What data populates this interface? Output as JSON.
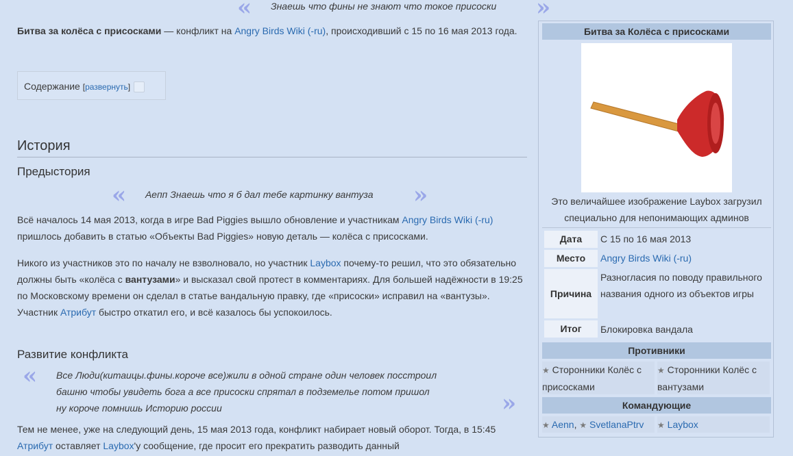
{
  "top_quote": "Знаешь что фины не знают что токое присоски",
  "intro": {
    "bold": "Битва за колёса с присосками",
    "t1": " — конфликт на ",
    "link": "Angry Birds Wiki (-ru)",
    "t2": ", происходивший с 15 по 16 мая 2013 года."
  },
  "toc": {
    "label": "Содержание",
    "open": "[",
    "toggle": "развернуть",
    "close": "]"
  },
  "history_heading": "История",
  "prehistory_heading": "Предыстория",
  "prehistory_quote": "Аепп Знаешь что я б дал тебе картинку вантуза",
  "p1": {
    "t1": "Всё началось 14 мая 2013, когда в игре Bad Piggies вышло обновление и участникам ",
    "link": "Angry Birds Wiki (-ru)",
    "t2": " пришлось добавить в статью «Объекты Bad Piggies» новую деталь — колёса с присосками."
  },
  "p2": {
    "t1": "Никого из участников это по началу не взволновало, но участник ",
    "link1": "Laybox",
    "t2": " почему-то решил, что это обязательно должны быть «колёса с ",
    "bold": "вантузами",
    "t3": "» и высказал свой протест в комментариях. Для большей надёжности в 19:25 по Московскому времени он сделал в статье вандальную правку, где «присоски» исправил на «вантузы». Участник ",
    "link2": "Атрибут",
    "t4": " быстро откатил его, и всё казалось бы успокоилось."
  },
  "development_heading": "Развитие конфликта",
  "dev_quote": {
    "line1": "Все Люди(китаицы.фины.короче все)жили в одной стране один человек посстроил",
    "line2": "башню чтобы увидеть бога а все присоски спрятал в подземелье потом пришол",
    "line3": "ну короче помнишь Историю россии"
  },
  "p3": {
    "t1": "Тем не менее, уже на следующий день, 15 мая 2013 года, конфликт набирает новый оборот. Тогда, в 15:45 ",
    "link1": "Атрибут",
    "t2": " оставляет ",
    "link2": "Laybox",
    "t3": "'у сообщение, где просит его прекратить разводить данный"
  },
  "infobox": {
    "title": "Битва за Колёса с присосками",
    "caption": "Это величайшее изображение Laybox загрузил специально для непонимающих админов",
    "rows": [
      {
        "label": "Дата",
        "value": "С 15 по 16 мая 2013"
      },
      {
        "label": "Место",
        "value": "Angry Birds Wiki (-ru)"
      },
      {
        "label": "Причина",
        "value": "Разногласия по поводу правильного названия одного из объектов игры"
      },
      {
        "label": "Итог",
        "value": "Блокировка вандала"
      }
    ],
    "opponents_title": "Противники",
    "opponents": [
      "Сторонники Колёс с присосками",
      "Сторонники Колёс с вантузами"
    ],
    "commanders_title": "Командующие",
    "commanders_left": [
      "Aenn",
      "SvetlanaPtrv"
    ],
    "commanders_sep": ",",
    "commanders_right": "Laybox"
  },
  "icons": {
    "quote_open": "«",
    "quote_close": "»",
    "star": "★"
  },
  "colors": {
    "background": "#d4e1f3",
    "link": "#2a6ab0",
    "quote_mark": "#9aa7e8",
    "infobox_header": "#b1c6e0",
    "plunger_cup": "#cc2a2a",
    "plunger_handle": "#d9983f"
  }
}
